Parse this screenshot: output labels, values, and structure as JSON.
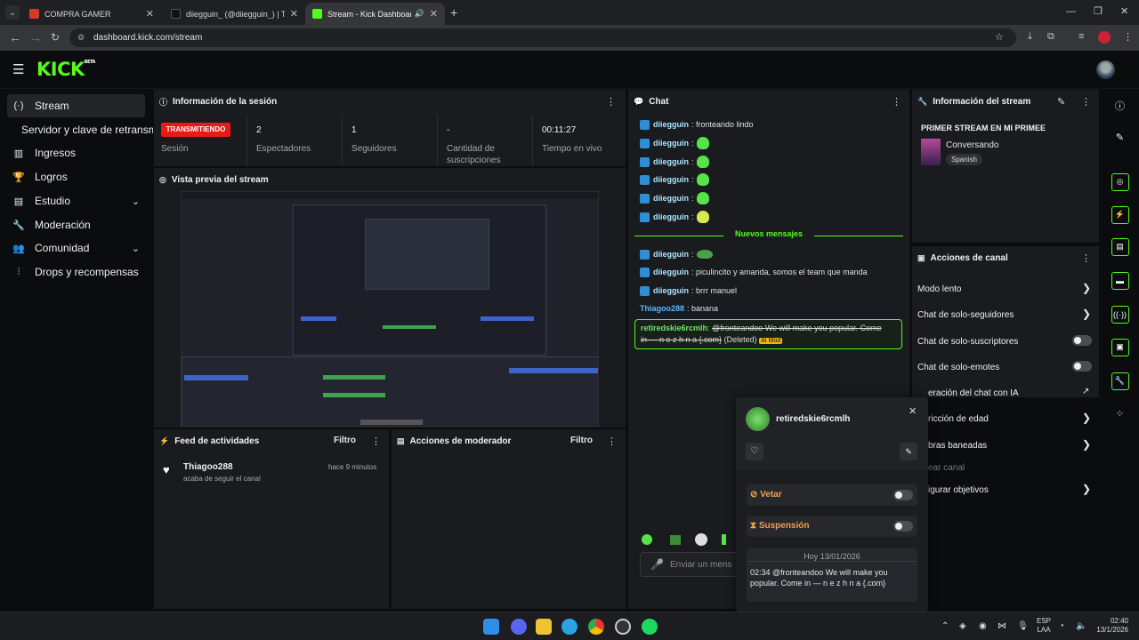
{
  "browser": {
    "tabs": [
      {
        "title": "COMPRA GAMER",
        "color": "#d33a2c"
      },
      {
        "title": "diiegguin_ (@diiegguin_) | TikTok",
        "color": "#111111"
      },
      {
        "title": "Stream - Kick Dashboard",
        "color": "#53fc18"
      }
    ],
    "url": "dashboard.kick.com/stream"
  },
  "kick": {
    "logo": "KICK",
    "logo_badge": "BETA"
  },
  "sidebar": {
    "items": [
      {
        "label": "Stream",
        "icon": "broadcast-icon"
      },
      {
        "label": "Servidor y clave de retransmisión"
      },
      {
        "label": "Ingresos",
        "icon": "chart-icon"
      },
      {
        "label": "Logros",
        "icon": "trophy-icon"
      },
      {
        "label": "Estudio",
        "icon": "studio-icon"
      },
      {
        "label": "Moderación",
        "icon": "wrench-icon"
      },
      {
        "label": "Comunidad",
        "icon": "community-icon"
      },
      {
        "label": "Drops y recompensas",
        "icon": "drops-icon"
      }
    ]
  },
  "session": {
    "title": "Información de la sesión",
    "status": "TRANSMITIENDO",
    "status_label": "Sesión",
    "stats": [
      {
        "value": "2",
        "label": "Espectadores"
      },
      {
        "value": "1",
        "label": "Seguidores"
      },
      {
        "value": "-",
        "label": "Cantidad de suscripciones"
      },
      {
        "value": "00:11:27",
        "label": "Tiempo en vivo"
      }
    ]
  },
  "preview": {
    "title": "Vista previa del stream"
  },
  "activity": {
    "title": "Feed de actividades",
    "filter": "Filtro",
    "items": [
      {
        "user": "Thiagoo288",
        "action": "acaba de seguir el canal",
        "time": "hace 9 minutos"
      }
    ]
  },
  "modactions": {
    "title": "Acciones de moderador",
    "filter": "Filtro"
  },
  "chat": {
    "title": "Chat",
    "messages": [
      {
        "user": "diiegguin",
        "text": "fronteando lindo"
      },
      {
        "user": "diiegguin",
        "text": ""
      },
      {
        "user": "diiegguin",
        "text": ""
      },
      {
        "user": "diiegguin",
        "text": ""
      },
      {
        "user": "diiegguin",
        "text": ""
      },
      {
        "user": "diiegguin",
        "text": ""
      }
    ],
    "new_messages": "Nuevos mensajes",
    "messages2": [
      {
        "user": "diiegguin",
        "text": ""
      },
      {
        "user": "diiegguin",
        "text": "piculincito y amanda, somos el team que manda"
      },
      {
        "user": "diiegguin",
        "text": "brrr manuel"
      },
      {
        "user": "Thiagoo288",
        "text": "banana"
      }
    ],
    "flagged": {
      "user": "retiredskie6rcmlh",
      "text_line1": "@fronteandoo We will make you popular. Come",
      "text_line2": "in — n e z h n a {.com}",
      "deleted": "(Deleted)",
      "aimod": "AI Mod"
    },
    "input_placeholder": "Enviar un mensaje"
  },
  "streaminfo": {
    "title": "Información del stream",
    "stream_title": "PRIMER STREAM EN MI PRIMEE",
    "category": "Conversando",
    "language": "Spanish"
  },
  "channel_actions": {
    "title": "Acciones de canal",
    "items": [
      {
        "label": "Modo lento",
        "control": "arrow"
      },
      {
        "label": "Chat de solo-seguidores",
        "control": "arrow"
      },
      {
        "label": "Chat de solo-suscriptores",
        "control": "toggle"
      },
      {
        "label": "Chat de solo-emotes",
        "control": "toggle"
      },
      {
        "label": "eración del chat con IA",
        "control": "external"
      },
      {
        "label": "ricción de edad",
        "control": "arrow"
      },
      {
        "label": "bras baneadas",
        "control": "arrow"
      },
      {
        "label": "ear canal",
        "control": "none"
      },
      {
        "label": "igurar objetivos",
        "control": "arrow"
      }
    ]
  },
  "user_card": {
    "username": "retiredskie6rcmlh",
    "ban_label": "Vetar",
    "timeout_label": "Suspensión",
    "date_label": "Hoy 13/01/2026",
    "message": "02:34 @fronteandoo We will make you popular. Come in — n e z h n a {.com}"
  },
  "taskbar": {
    "lang": "ESP",
    "lang2": "LAA",
    "time": "02:40",
    "date": "13/1/2026"
  }
}
